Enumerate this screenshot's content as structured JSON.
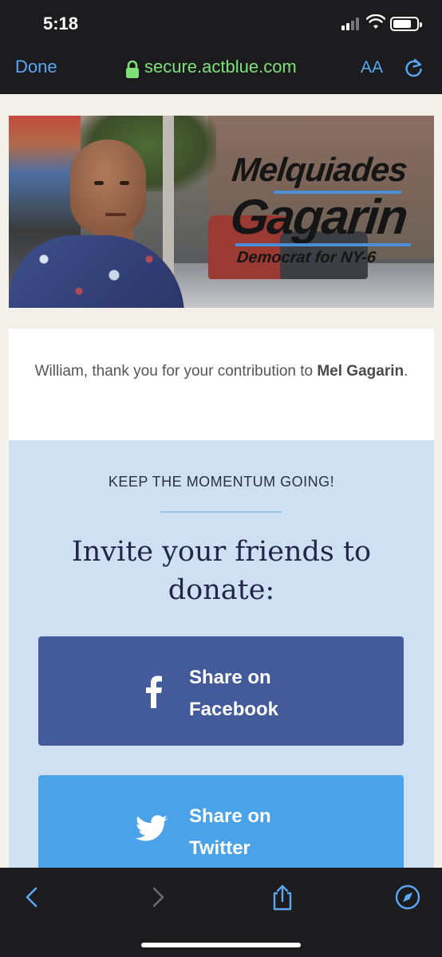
{
  "status_bar": {
    "time": "5:18"
  },
  "browser": {
    "done_label": "Done",
    "url": "secure.actblue.com",
    "text_size_label": "AA"
  },
  "banner": {
    "logo_line1": "Melquiades",
    "logo_line2": "Gagarin",
    "logo_line3": "Democrat for NY-6",
    "accent_color": "#4a8fd6"
  },
  "thanks": {
    "prefix": "William, thank you for your contribution to ",
    "recipient": "Mel Gagarin",
    "suffix": "."
  },
  "share": {
    "kicker": "KEEP THE MOMENTUM GOING!",
    "heading": "Invite your friends to donate:",
    "facebook_label": "Share on Facebook",
    "twitter_label": "Share on Twitter",
    "facebook_color": "#435b9a",
    "twitter_color": "#4aa2e8"
  },
  "toolbar": {
    "icons": [
      "back-icon",
      "forward-icon",
      "share-icon",
      "compass-icon"
    ]
  }
}
